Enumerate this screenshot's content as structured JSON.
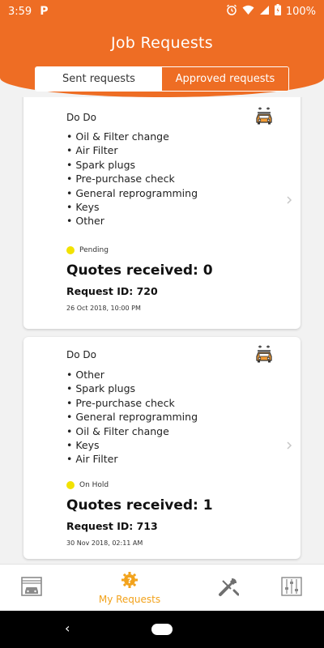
{
  "status_bar": {
    "time": "3:59",
    "app_badge": "P",
    "battery": "100%"
  },
  "header": {
    "title": "Job Requests",
    "tabs": [
      {
        "label": "Sent requests",
        "selected": false
      },
      {
        "label": "Approved requests",
        "selected": true
      }
    ]
  },
  "colors": {
    "brand": "#ee6d24",
    "nav_active": "#f2a21b",
    "status_dot": "#f2e200"
  },
  "requests": [
    {
      "title": "Do Do",
      "services": [
        "Oil & Filter change",
        "Air Filter",
        "Spark plugs",
        "Pre-purchase check",
        "General reprogramming",
        "Keys",
        "Other"
      ],
      "status": "Pending",
      "quotes": "Quotes received: 0",
      "request_id": "Request ID: 720",
      "date": "26 Oct 2018, 10:00 PM"
    },
    {
      "title": "Do Do",
      "services": [
        "Other",
        "Spark plugs",
        "Pre-purchase check",
        "General reprogramming",
        "Oil & Filter change",
        "Keys",
        "Air Filter"
      ],
      "status": "On Hold",
      "quotes": "Quotes received: 1",
      "request_id": "Request ID: 713",
      "date": "30 Nov 2018, 02:11 AM"
    }
  ],
  "bottom_nav": {
    "items": [
      {
        "icon": "garage-icon",
        "label": ""
      },
      {
        "icon": "my-requests-icon",
        "label": "My Requests",
        "active": true
      },
      {
        "icon": "tools-icon",
        "label": ""
      },
      {
        "icon": "settings-sliders-icon",
        "label": ""
      }
    ]
  }
}
